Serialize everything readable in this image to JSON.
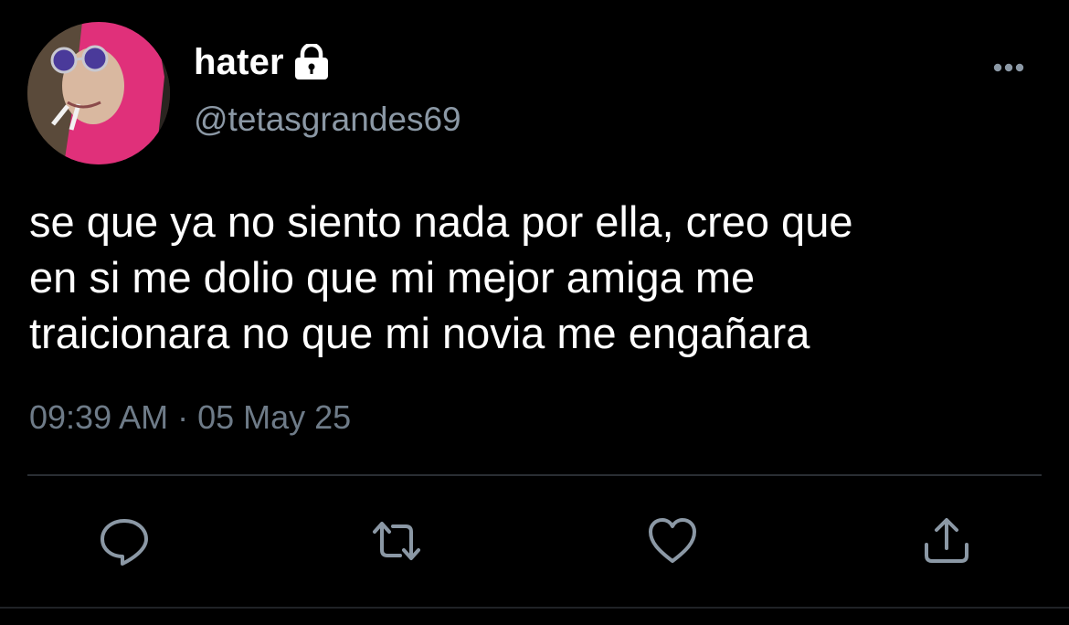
{
  "tweet": {
    "author": {
      "display_name": "hater",
      "handle": "@tetasgrandes69",
      "avatar_icon": "avatar-photo",
      "protected_icon": "lock-icon"
    },
    "text": "se que ya no siento nada por ella, creo que\nen si me dolio que mi mejor amiga me\ntraicionara no que mi novia me engañara",
    "timestamp": "09:39 AM · 05 May 25",
    "actions": [
      {
        "name": "reply",
        "icon": "reply-icon"
      },
      {
        "name": "retweet",
        "icon": "retweet-icon"
      },
      {
        "name": "like",
        "icon": "heart-icon"
      },
      {
        "name": "share",
        "icon": "share-icon"
      }
    ],
    "more_icon": "more-options-icon"
  },
  "colors": {
    "background": "#000000",
    "primary_text": "#ffffff",
    "secondary_text": "#8b98a5",
    "icon": "#8b98a5",
    "divider": "#2a2e33"
  }
}
